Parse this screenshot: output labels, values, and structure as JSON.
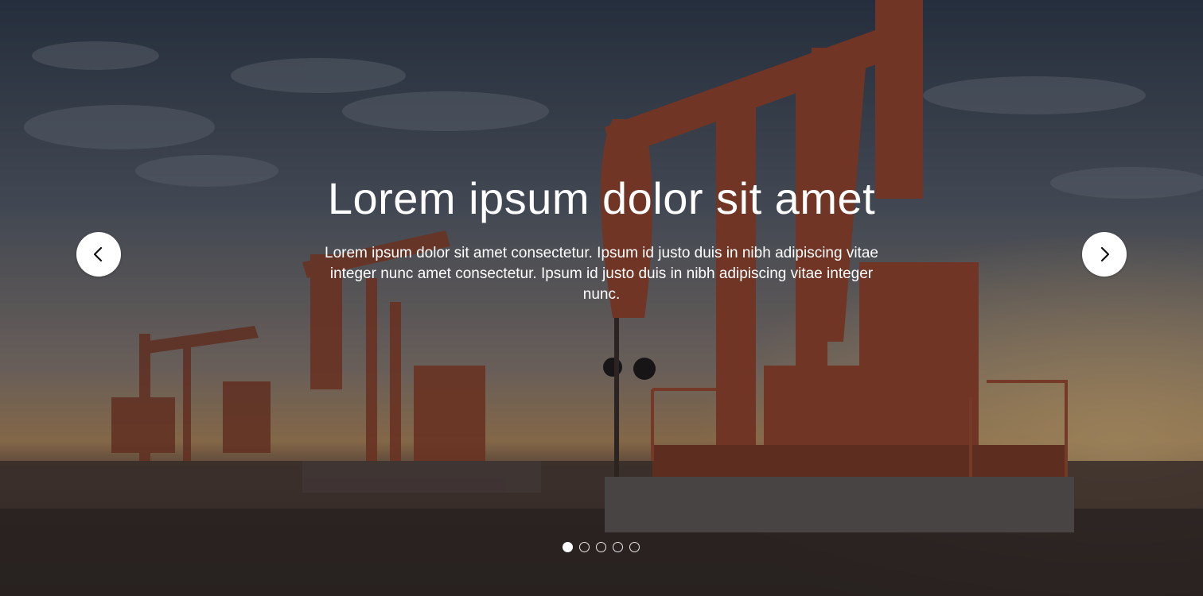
{
  "slide": {
    "title": "Lorem ipsum dolor sit amet",
    "body": "Lorem ipsum dolor sit amet consectetur. Ipsum id justo duis in nibh adipiscing vitae integer nunc amet consectetur. Ipsum id justo duis in nibh adipiscing vitae integer nunc."
  },
  "navigation": {
    "prev_icon": "chevron-left-icon",
    "next_icon": "chevron-right-icon"
  },
  "pagination": {
    "total": 5,
    "active_index": 0
  },
  "colors": {
    "button_bg": "#ffffff",
    "text": "#ffffff",
    "pump_orange": "#c2552e"
  }
}
